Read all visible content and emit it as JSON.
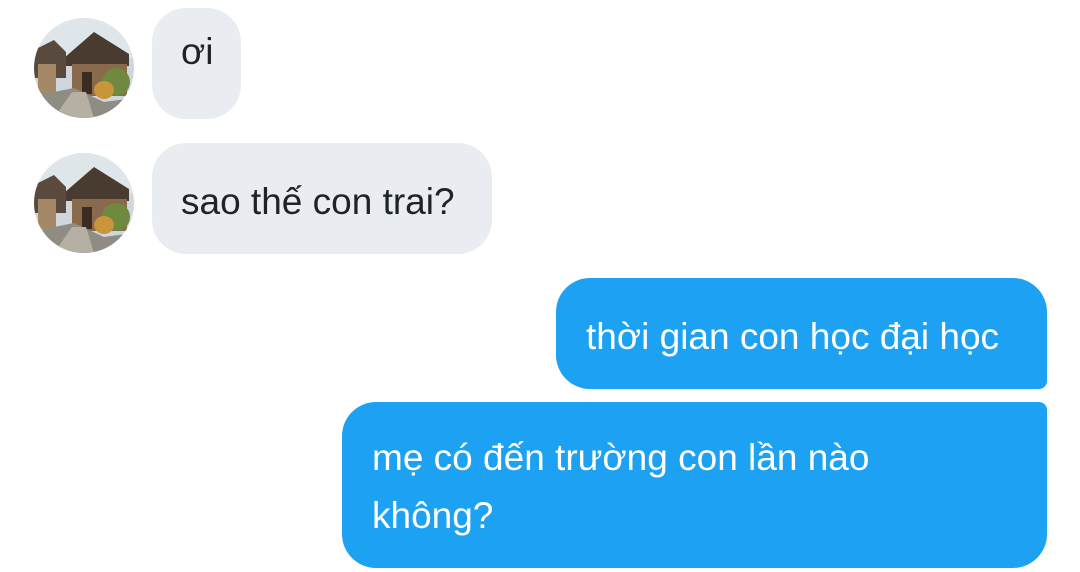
{
  "conversation": {
    "messages": [
      {
        "sender": "other",
        "avatar_icon": "hanok-village-photo-avatar",
        "text": "ơi"
      },
      {
        "sender": "other",
        "avatar_icon": "hanok-village-photo-avatar",
        "text": "sao thế con trai?"
      },
      {
        "sender": "self",
        "text": "thời gian con học đại học"
      },
      {
        "sender": "self",
        "text_line1": "mẹ có đến trường con lần nào",
        "text_line2": "không?"
      }
    ]
  },
  "colors": {
    "incoming_bubble": "#e9edf2",
    "outgoing_bubble": "#1da1f2",
    "incoming_text": "#1f2328",
    "outgoing_text": "#ffffff"
  }
}
